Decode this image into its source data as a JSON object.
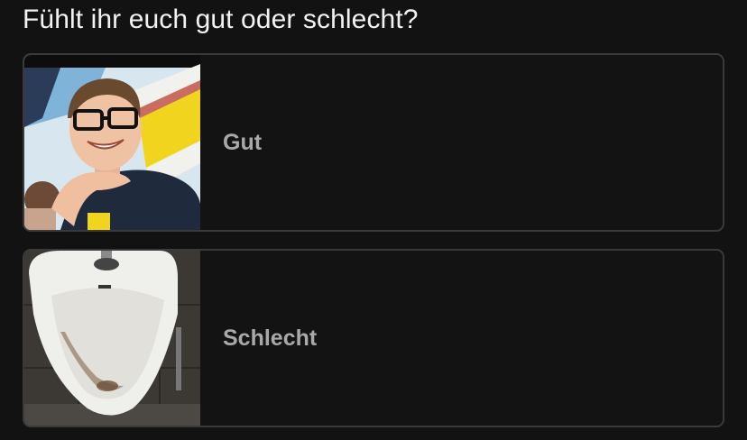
{
  "poll": {
    "question": "Fühlt ihr euch gut oder schlecht?",
    "options": [
      {
        "label": "Gut",
        "image": "smiling-man-photo"
      },
      {
        "label": "Schlecht",
        "image": "urinal-photo"
      }
    ]
  }
}
